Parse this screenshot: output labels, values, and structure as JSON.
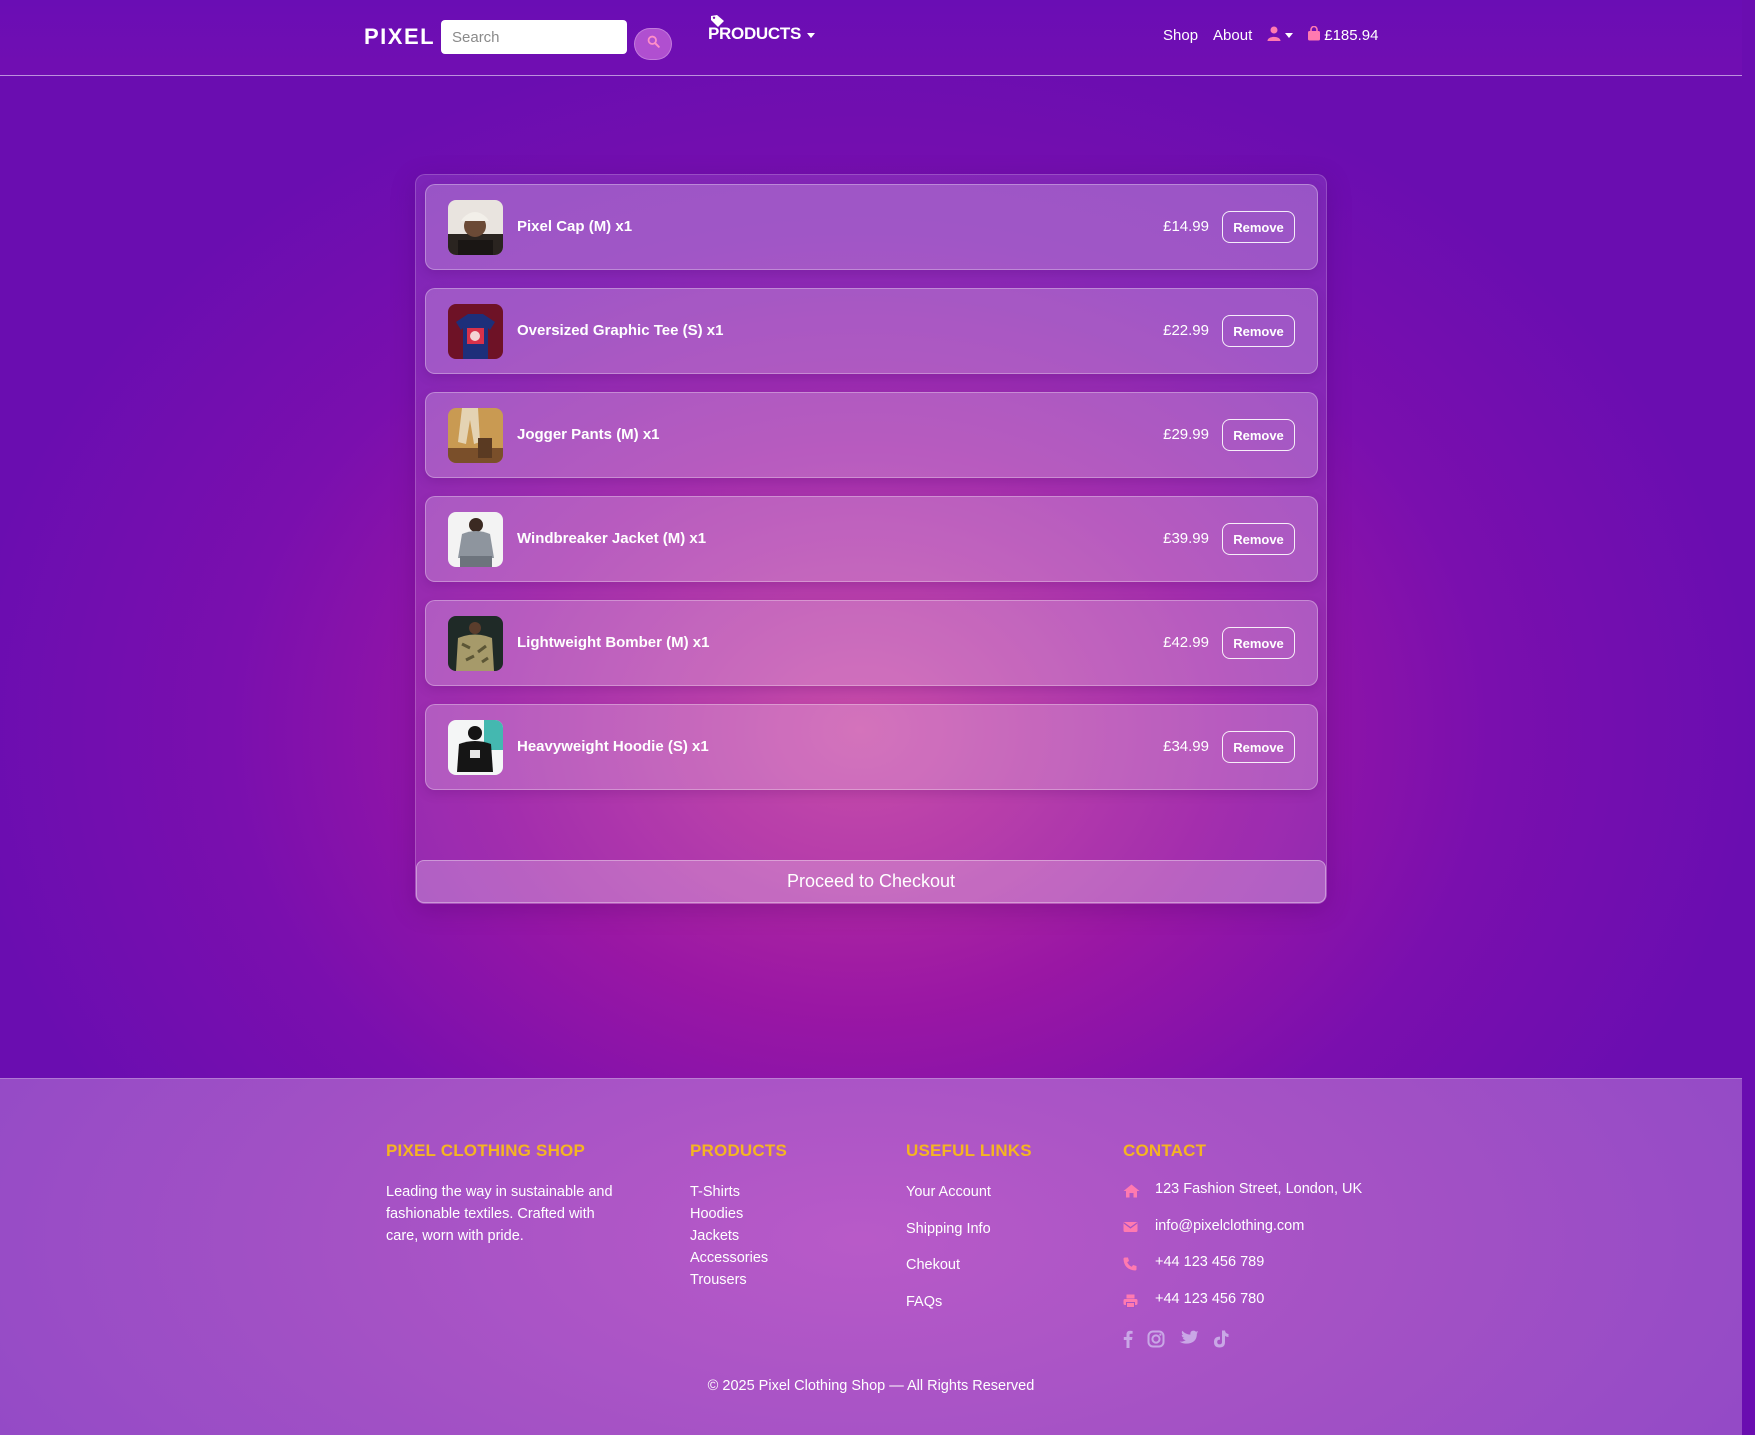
{
  "navbar": {
    "brand": "PIXEL",
    "search_placeholder": "Search",
    "products_label": "PRODUCTS",
    "shop_link": "Shop",
    "about_link": "About",
    "cart_total": "£185.94"
  },
  "cart": {
    "items": [
      {
        "name": "Pixel Cap (M) x1",
        "price": "£14.99",
        "remove_label": "Remove"
      },
      {
        "name": "Oversized Graphic Tee (S) x1",
        "price": "£22.99",
        "remove_label": "Remove"
      },
      {
        "name": "Jogger Pants (M) x1",
        "price": "£29.99",
        "remove_label": "Remove"
      },
      {
        "name": "Windbreaker Jacket (M) x1",
        "price": "£39.99",
        "remove_label": "Remove"
      },
      {
        "name": "Lightweight Bomber (M) x1",
        "price": "£42.99",
        "remove_label": "Remove"
      },
      {
        "name": "Heavyweight Hoodie (S) x1",
        "price": "£34.99",
        "remove_label": "Remove"
      }
    ],
    "checkout_label": "Proceed to Checkout"
  },
  "footer": {
    "shop_heading": "PIXEL CLOTHING SHOP",
    "shop_text": "Leading the way in sustainable and fashionable textiles. Crafted with care, worn with pride.",
    "products_heading": "PRODUCTS",
    "products": [
      "T-Shirts",
      "Hoodies",
      "Jackets",
      "Accessories",
      "Trousers"
    ],
    "links_heading": "USEFUL LINKS",
    "links": [
      "Your Account",
      "Shipping Info",
      "Chekout",
      "FAQs"
    ],
    "contact_heading": "CONTACT",
    "contact": {
      "address": "123 Fashion Street, London, UK",
      "email": "info@pixelclothing.com",
      "phone": "+44 123 456 789",
      "fax": "+44 123 456 780"
    },
    "copyright": "© 2025 Pixel Clothing Shop — All Rights Reserved"
  },
  "colors": {
    "heading_accent": "#f5b521",
    "contact_icon": "#ff7ab0",
    "social_icon": "#c9a7e6"
  },
  "icons": [
    "search-icon",
    "tag-icon",
    "user-icon",
    "shopping-bag-icon",
    "home-icon",
    "envelope-icon",
    "phone-icon",
    "printer-icon",
    "facebook-icon",
    "instagram-icon",
    "twitter-icon",
    "tiktok-icon"
  ]
}
